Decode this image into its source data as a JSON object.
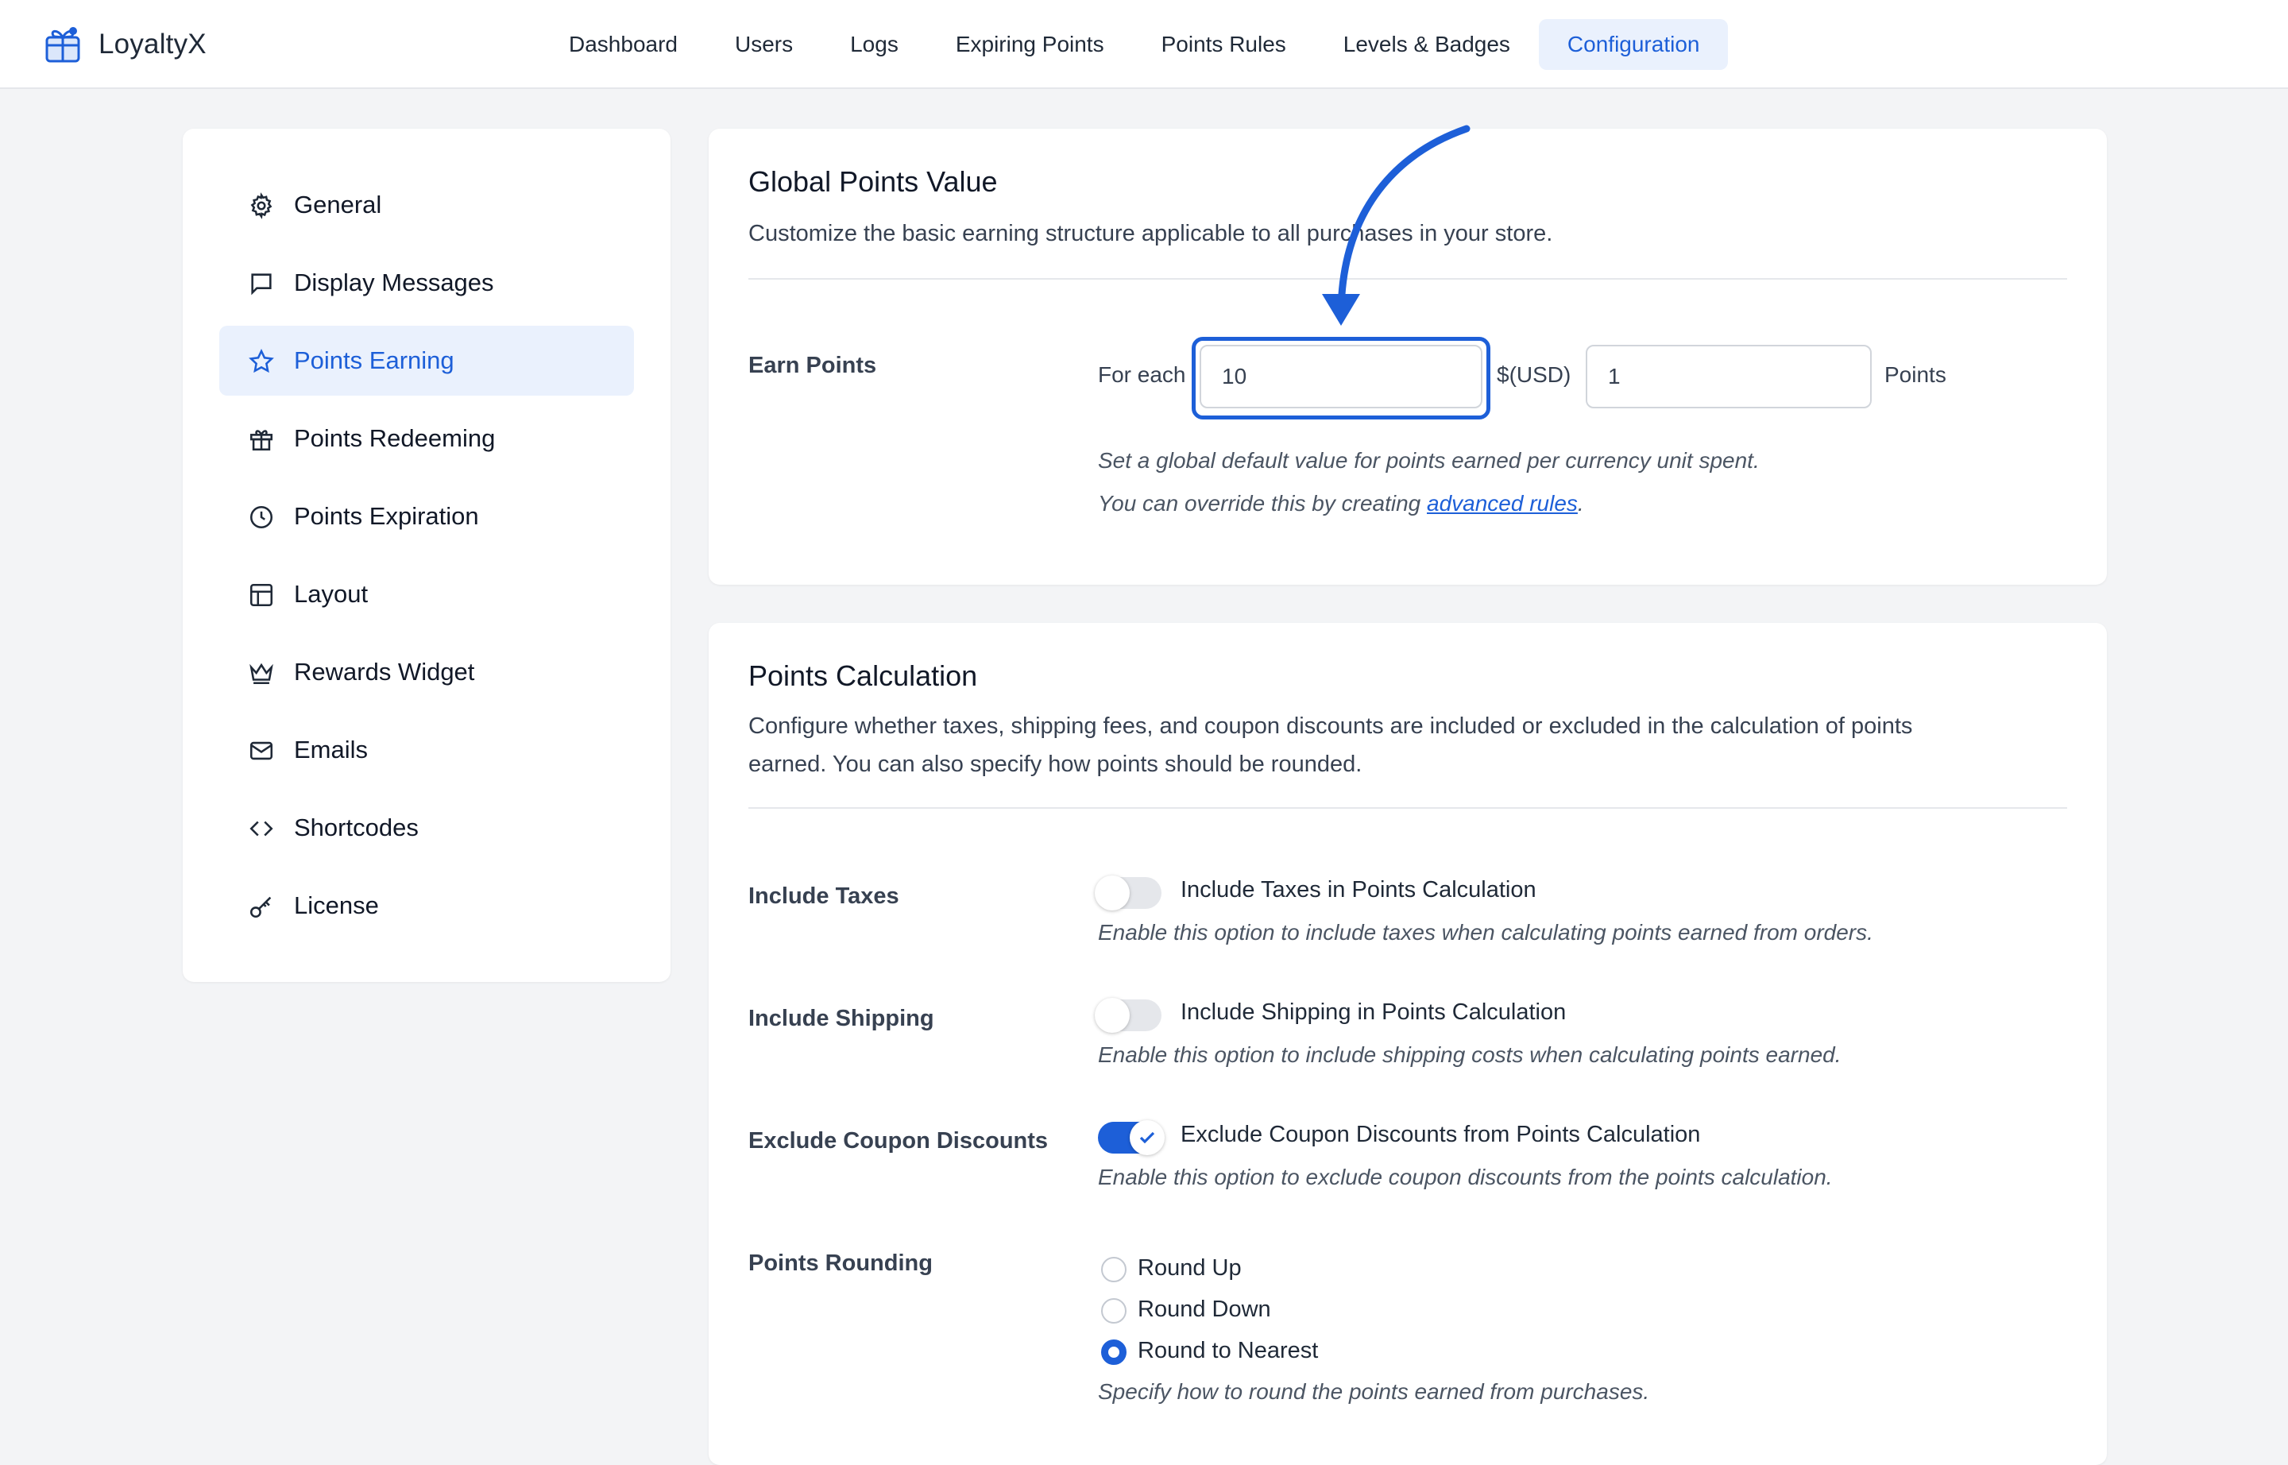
{
  "app": {
    "name": "LoyaltyX"
  },
  "nav": [
    {
      "label": "Dashboard",
      "active": false
    },
    {
      "label": "Users",
      "active": false
    },
    {
      "label": "Logs",
      "active": false
    },
    {
      "label": "Expiring Points",
      "active": false
    },
    {
      "label": "Points Rules",
      "active": false
    },
    {
      "label": "Levels & Badges",
      "active": false
    },
    {
      "label": "Configuration",
      "active": true
    }
  ],
  "sidebar": {
    "items": [
      {
        "label": "General",
        "icon": "gear-icon"
      },
      {
        "label": "Display Messages",
        "icon": "message-icon"
      },
      {
        "label": "Points Earning",
        "icon": "star-icon",
        "active": true
      },
      {
        "label": "Points Redeeming",
        "icon": "gift-icon"
      },
      {
        "label": "Points Expiration",
        "icon": "clock-icon"
      },
      {
        "label": "Layout",
        "icon": "layout-icon"
      },
      {
        "label": "Rewards Widget",
        "icon": "crown-icon"
      },
      {
        "label": "Emails",
        "icon": "mail-icon"
      },
      {
        "label": "Shortcodes",
        "icon": "code-icon"
      },
      {
        "label": "License",
        "icon": "key-icon"
      }
    ]
  },
  "global_points": {
    "title": "Global Points Value",
    "description": "Customize the basic earning structure applicable to all purchases in your store.",
    "earn_label": "Earn Points",
    "for_each": "For each",
    "amount_value": "10",
    "currency": "$(USD)",
    "points_value": "1",
    "points_unit": "Points",
    "hint_line1": "Set a global default value for points earned per currency unit spent.",
    "hint_line2_prefix": "You can override this by creating ",
    "hint_link": "advanced rules",
    "hint_line2_suffix": "."
  },
  "calculation": {
    "title": "Points Calculation",
    "description_line1": "Configure whether taxes, shipping fees, and coupon discounts are included or excluded in the calculation of points",
    "description_line2": "earned. You can also specify how points should be rounded.",
    "taxes": {
      "label": "Include Taxes",
      "toggle_label": "Include Taxes in Points Calculation",
      "hint": "Enable this option to include taxes when calculating points earned from orders.",
      "enabled": false
    },
    "shipping": {
      "label": "Include Shipping",
      "toggle_label": "Include Shipping in Points Calculation",
      "hint": "Enable this option to include shipping costs when calculating points earned.",
      "enabled": false
    },
    "coupons": {
      "label": "Exclude Coupon Discounts",
      "toggle_label": "Exclude Coupon Discounts from Points Calculation",
      "hint": "Enable this option to exclude coupon discounts from the points calculation.",
      "enabled": true
    },
    "rounding": {
      "label": "Points Rounding",
      "options": [
        "Round Up",
        "Round Down",
        "Round to Nearest"
      ],
      "selected": "Round to Nearest",
      "hint": "Specify how to round the points earned from purchases."
    }
  },
  "colors": {
    "accent": "#1d5fd8",
    "active_bg": "#eaf1fd"
  }
}
